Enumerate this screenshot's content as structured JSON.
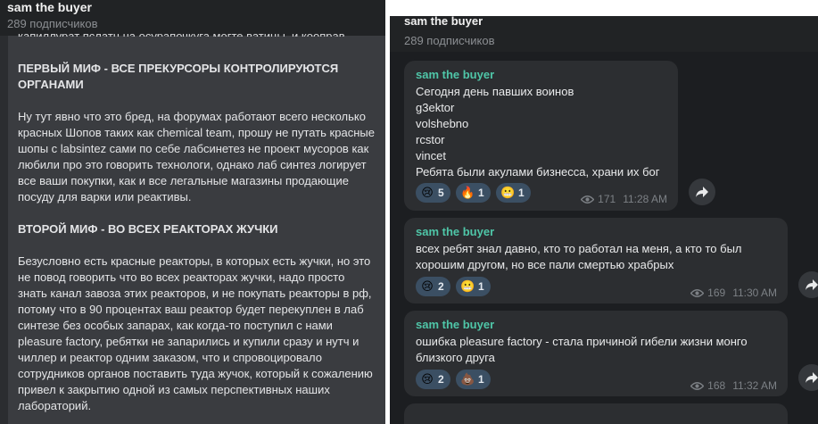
{
  "left": {
    "channel_name": "sam the buyer",
    "subscribers": "289 подписчиков",
    "paragraphs": [
      {
        "text": "ПЕРВЫЙ МИФ - ВСЕ ПРЕКУРСОРЫ КОНТРОЛИРУЮТСЯ ОРГАНАМИ",
        "bold": true
      },
      {
        "text": "Ну тут явно что это бред, на форумах работают всего несколько красных Шопов таких как chemical team, прошу не путать красные шопы с labsintez сами по себе лабсинетез не проект мусоров как любили про это говорить технологи, однако лаб синтез логирует все ваши покупки, как и все легальные магазины продающие посуду для варки или реактивы.",
        "bold": false
      },
      {
        "text": "ВТОРОЙ МИФ - ВО ВСЕХ РЕАКТОРАХ ЖУЧКИ",
        "bold": true
      },
      {
        "text": "Безусловно есть красные реакторы, в которых есть жучки, но это не повод говорить что во всех реакторах жучки, надо просто знать канал завоза этих реакторов, и не покупать реакторы в рф,  потому что в 90 процентах ваш реактор будет перекуплен в лаб синтезе без особых запарах, как когда-то поступил с нами pleasure factory, ребятки не запарились и купили сразу и нутч и чиллер и реактор одним заказом, что и спровоцировало сотрудников органов поставить туда жучок, который к сожалению привел к закрытию одной из самых перспективных наших лабораторий.",
        "bold": false
      }
    ]
  },
  "right": {
    "channel_name": "sam the buyer",
    "subscribers": "289 подписчиков",
    "messages": [
      {
        "author": "sam the buyer",
        "lines": [
          "Сегодня день павших воинов",
          "g3ektor",
          "volshebno",
          "rcstor",
          "vincet",
          "Ребята были акулами бизнесса, храни их бог"
        ],
        "reactions": [
          {
            "icon": "crying-face-icon",
            "emoji": "😢",
            "count": "5"
          },
          {
            "icon": "fire-icon",
            "emoji": "🔥",
            "count": "1"
          },
          {
            "icon": "grimacing-face-icon",
            "emoji": "😬",
            "count": "1"
          }
        ],
        "views": "171",
        "time": "11:28 AM"
      },
      {
        "author": "sam the buyer",
        "lines": [
          "всех ребят знал давно, кто то работал на меня, а кто то был",
          "хорошим другом, но все пали смертью храбрых"
        ],
        "reactions": [
          {
            "icon": "crying-face-icon",
            "emoji": "😢",
            "count": "2"
          },
          {
            "icon": "grimacing-face-icon",
            "emoji": "😬",
            "count": "1"
          }
        ],
        "views": "169",
        "time": "11:30 AM"
      },
      {
        "author": "sam the buyer",
        "lines": [
          "ошибка pleasure factory - стала причиной гибели жизни монго",
          "близкого друга"
        ],
        "reactions": [
          {
            "icon": "crying-face-icon",
            "emoji": "😢",
            "count": "2"
          },
          {
            "icon": "pile-of-poo-icon",
            "emoji": "💩",
            "count": "1"
          }
        ],
        "views": "168",
        "time": "11:32 AM"
      }
    ]
  }
}
